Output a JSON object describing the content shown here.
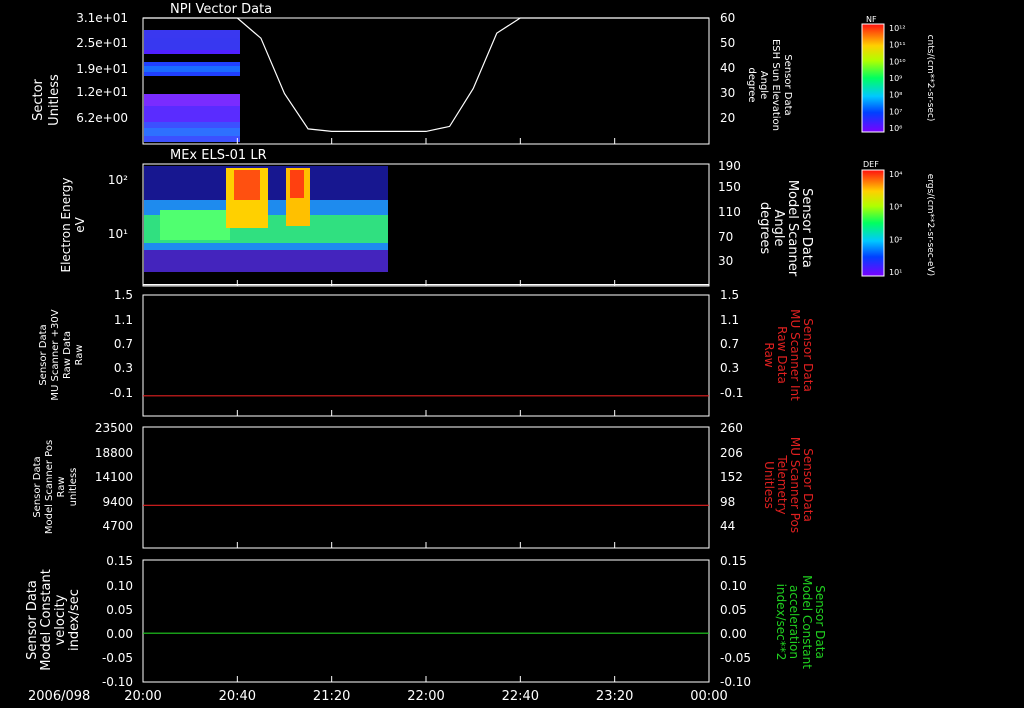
{
  "colors": {
    "red": "#e02020",
    "green": "#20d020",
    "white": "#ffffff"
  },
  "date_label": "2006/098",
  "x_axis": {
    "ticks": [
      "20:00",
      "20:40",
      "21:20",
      "22:00",
      "22:40",
      "23:20",
      "00:00"
    ]
  },
  "colorbars": [
    {
      "label": "NF",
      "unit": "cnts/(cm**2-sr-sec)",
      "ticks": [
        "10¹²",
        "10¹¹",
        "10¹⁰",
        "10⁹",
        "10⁸",
        "10⁷",
        "10⁶"
      ]
    },
    {
      "label": "DEF",
      "unit": "ergs/(cm**2-sr-sec-eV)",
      "ticks": [
        "10⁴",
        "10³",
        "10²",
        "10¹"
      ]
    }
  ],
  "chart_data": [
    {
      "type": "heatmap",
      "title": "NPI Vector Data",
      "ylabel": [
        "Sector",
        "Unitless"
      ],
      "ytick_labels": [
        "3.1e+01",
        "2.5e+01",
        "1.9e+01",
        "1.2e+01",
        "6.2e+00"
      ],
      "x_coverage": [
        "20:00",
        "20:40"
      ],
      "overlay": {
        "type": "line",
        "ylabel": [
          "Sensor Data",
          "ESH Sun Elevation",
          "Angle",
          "degree"
        ],
        "ytick_labels": [
          "60",
          "50",
          "40",
          "30",
          "20"
        ],
        "ylim": [
          10,
          60
        ],
        "x": [
          "20:00",
          "20:40",
          "20:50",
          "21:00",
          "21:10",
          "21:20",
          "22:00",
          "22:10",
          "22:20",
          "22:30",
          "22:40",
          "23:20",
          "00:00"
        ],
        "y": [
          60,
          60,
          52,
          30,
          16,
          15,
          15,
          17,
          32,
          54,
          60,
          60,
          60
        ]
      }
    },
    {
      "type": "heatmap",
      "title": "MEx ELS-01 LR",
      "ylabel": [
        "Electron Energy",
        "eV"
      ],
      "ytick_labels": [
        "10²",
        "10¹"
      ],
      "x_coverage": [
        "20:00",
        "21:50"
      ],
      "overlay": {
        "type": "line",
        "ylabel": [
          "Sensor Data",
          "Model Scanner",
          "Angle",
          "degrees"
        ],
        "ytick_labels": [
          "190",
          "150",
          "110",
          "70",
          "30"
        ],
        "ylim": [
          10,
          190
        ],
        "x": [
          "20:00",
          "00:00"
        ],
        "y": [
          12,
          12
        ]
      }
    },
    {
      "type": "line",
      "ylabel": [
        "Sensor Data",
        "MU Scanner +30V",
        "Raw Data",
        "Raw"
      ],
      "ytick_labels": [
        "1.5",
        "1.1",
        "0.7",
        "0.3",
        "-0.1"
      ],
      "ylim": [
        -0.3,
        1.5
      ],
      "right_ylabel": [
        "Sensor Data",
        "MU Scanner Int",
        "Raw Data",
        "Raw"
      ],
      "right_ytick_labels": [
        "1.5",
        "1.1",
        "0.7",
        "0.3",
        "-0.1"
      ],
      "series": [
        {
          "color": "red",
          "x": [
            "20:00",
            "00:00"
          ],
          "y": [
            0.0,
            0.0
          ]
        }
      ]
    },
    {
      "type": "line",
      "ylabel": [
        "Sensor Data",
        "Model Scanner Pos",
        "Raw",
        "unitless"
      ],
      "ytick_labels": [
        "23500",
        "18800",
        "14100",
        "9400",
        "4700"
      ],
      "ylim": [
        0,
        23500
      ],
      "right_ylabel": [
        "Sensor Data",
        "MU Scanner Pos",
        "Telemetry",
        "Unitless"
      ],
      "right_ytick_labels": [
        "260",
        "206",
        "152",
        "98",
        "44"
      ],
      "series": [
        {
          "color": "red",
          "x": [
            "20:00",
            "00:00"
          ],
          "y": [
            8300,
            8300
          ]
        }
      ]
    },
    {
      "type": "line",
      "ylabel": [
        "Sensor Data",
        "Model Constant",
        "velocity",
        "index/sec"
      ],
      "ytick_labels": [
        "0.15",
        "0.10",
        "0.05",
        "0.00",
        "-0.05",
        "-0.10"
      ],
      "ylim": [
        -0.1,
        0.15
      ],
      "right_ylabel": [
        "Sensor Data",
        "Model Constant",
        "acceleration",
        "index/sec**2"
      ],
      "right_ytick_labels": [
        "0.15",
        "0.10",
        "0.05",
        "0.00",
        "-0.05",
        "-0.10"
      ],
      "series": [
        {
          "color": "green",
          "x": [
            "20:00",
            "00:00"
          ],
          "y": [
            0.0,
            0.0
          ]
        }
      ]
    }
  ]
}
